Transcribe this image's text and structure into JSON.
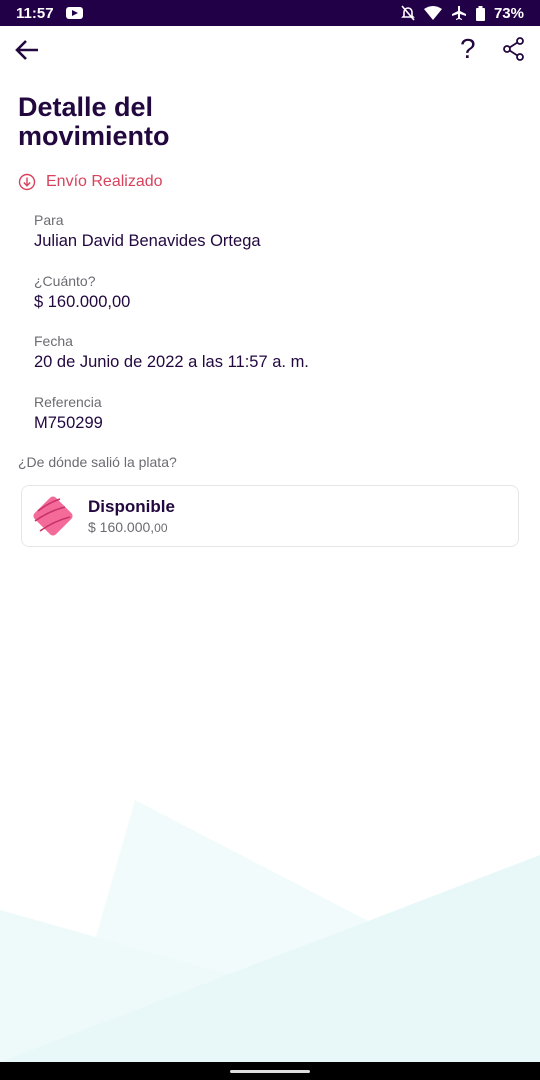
{
  "status_bar": {
    "time": "11:57",
    "battery": "73%",
    "icons": [
      "youtube-icon",
      "bell-off-icon",
      "wifi-icon",
      "airplane-icon",
      "battery-icon"
    ]
  },
  "header": {
    "help": "?",
    "title": "Detalle del movimiento"
  },
  "transaction": {
    "type": "Envío Realizado",
    "type_color": "#d8425c",
    "fields": [
      {
        "label": "Para",
        "value": "Julian David Benavides Ortega"
      },
      {
        "label": "¿Cuánto?",
        "value": "$ 160.000,00"
      },
      {
        "label": "Fecha",
        "value": "20 de Junio de 2022 a las 11:57 a. m."
      },
      {
        "label": "Referencia",
        "value": "M750299"
      }
    ]
  },
  "source": {
    "question": "¿De dónde salió la plata?",
    "name": "Disponible",
    "amount": "$ 160.000,",
    "amount_cents": "00"
  },
  "colors": {
    "primary": "#22083f",
    "status_bar": "#220048",
    "accent": "#d8425c"
  }
}
